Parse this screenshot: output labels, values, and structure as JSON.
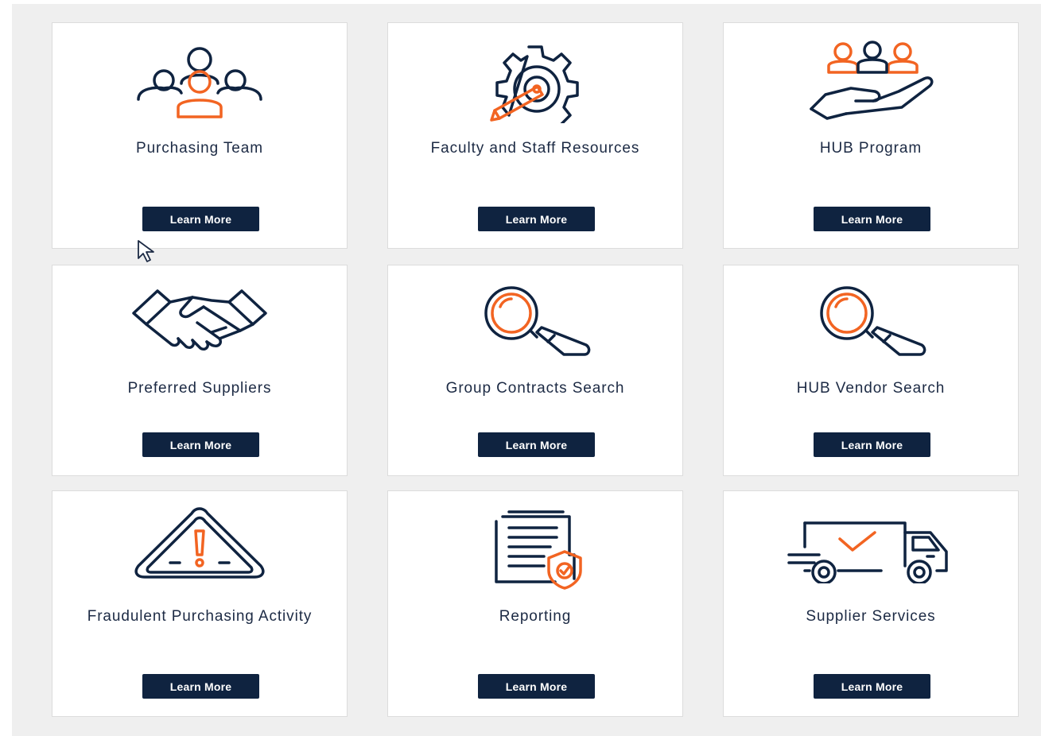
{
  "colors": {
    "navy": "#0f2340",
    "orange": "#f26422",
    "background": "#efefef"
  },
  "cards": [
    {
      "title": "Purchasing Team",
      "icon": "people-group-icon",
      "button": "Learn More"
    },
    {
      "title": "Faculty and Staff Resources",
      "icon": "gear-pencil-icon",
      "button": "Learn More"
    },
    {
      "title": "HUB Program",
      "icon": "hand-holding-people-icon",
      "button": "Learn More"
    },
    {
      "title": "Preferred Suppliers",
      "icon": "handshake-icon",
      "button": "Learn More"
    },
    {
      "title": "Group Contracts Search",
      "icon": "magnifier-icon",
      "button": "Learn More"
    },
    {
      "title": "HUB Vendor Search",
      "icon": "magnifier-icon",
      "button": "Learn More"
    },
    {
      "title": "Fraudulent Purchasing Activity",
      "icon": "warning-triangle-icon",
      "button": "Learn More"
    },
    {
      "title": "Reporting",
      "icon": "documents-shield-icon",
      "button": "Learn More"
    },
    {
      "title": "Supplier Services",
      "icon": "delivery-truck-icon",
      "button": "Learn More"
    }
  ]
}
